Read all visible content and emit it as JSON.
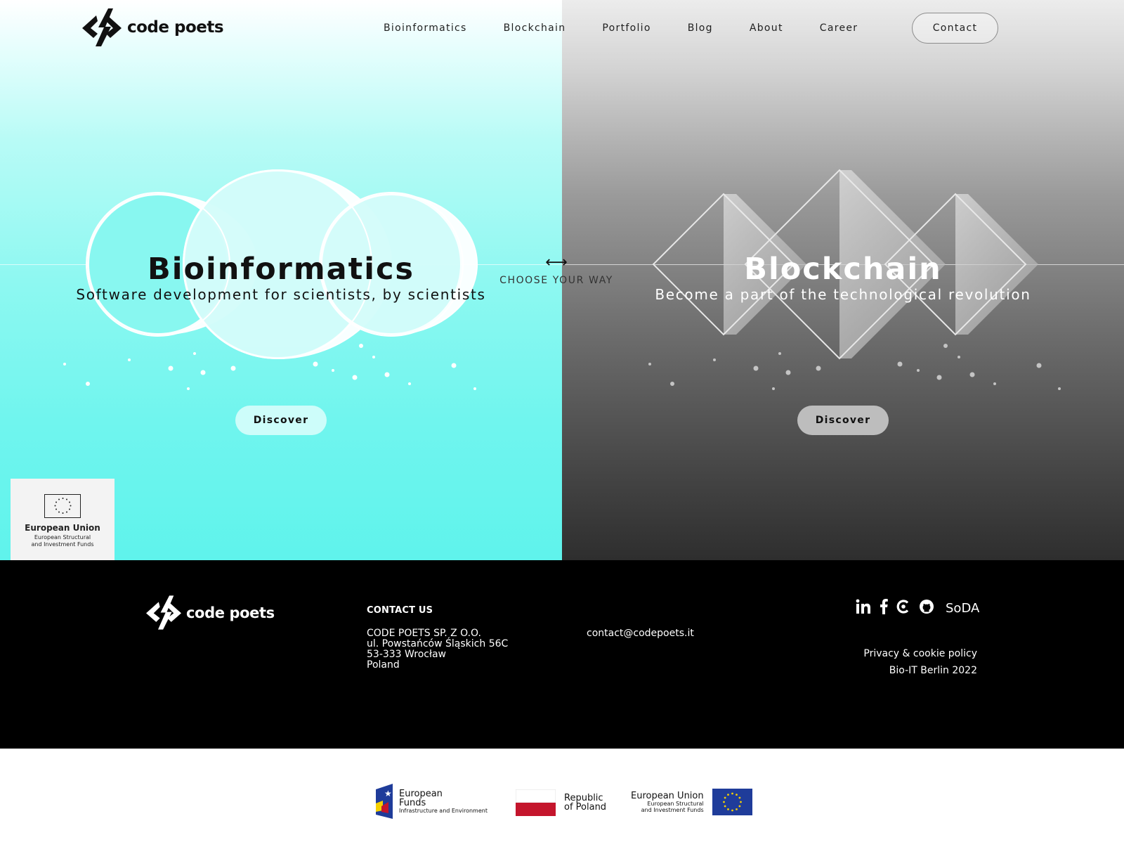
{
  "header": {
    "logo_text": "code poets",
    "nav": [
      "Bioinformatics",
      "Blockchain",
      "Portfolio",
      "Blog",
      "About",
      "Career"
    ],
    "contact_label": "Contact"
  },
  "hero": {
    "choose_label": "CHOOSE YOUR WAY",
    "left": {
      "title": "Bioinformatics",
      "subtitle": "Software development for scientists, by scientists",
      "button": "Discover"
    },
    "right": {
      "title": "Blockchain",
      "subtitle": "Become a part of the technological revolution",
      "button": "Discover"
    },
    "eu_badge": {
      "title": "European Union",
      "sub1": "European Structural",
      "sub2": "and Investment Funds"
    }
  },
  "footer": {
    "logo_text": "code poets",
    "contact_heading": "CONTACT US",
    "address": [
      "CODE POETS SP. Z O.O.",
      "ul. Powstańców Śląskich 56C",
      "53-333 Wrocław",
      "Poland"
    ],
    "email": "contact@codepoets.it",
    "social": [
      "linkedin-icon",
      "facebook-icon",
      "clutch-icon",
      "github-icon"
    ],
    "soda_label": "SoDA",
    "links": [
      "Privacy & cookie policy",
      "Bio-IT Berlin 2022"
    ]
  },
  "funding": {
    "eu_funds": {
      "title1": "European",
      "title2": "Funds",
      "sub": "Infrastructure and Environment"
    },
    "poland": {
      "title1": "Republic",
      "title2": "of Poland"
    },
    "eu": {
      "title": "European Union",
      "sub1": "European Structural",
      "sub2": "and Investment Funds"
    }
  },
  "colors": {
    "bio_panel": "#5ff3ec",
    "chain_panel": "#6c6c6c",
    "footer_bg": "#000000",
    "eu_blue": "#1f3c9a",
    "eu_star": "#f5d000",
    "poland_red": "#c4152c"
  }
}
